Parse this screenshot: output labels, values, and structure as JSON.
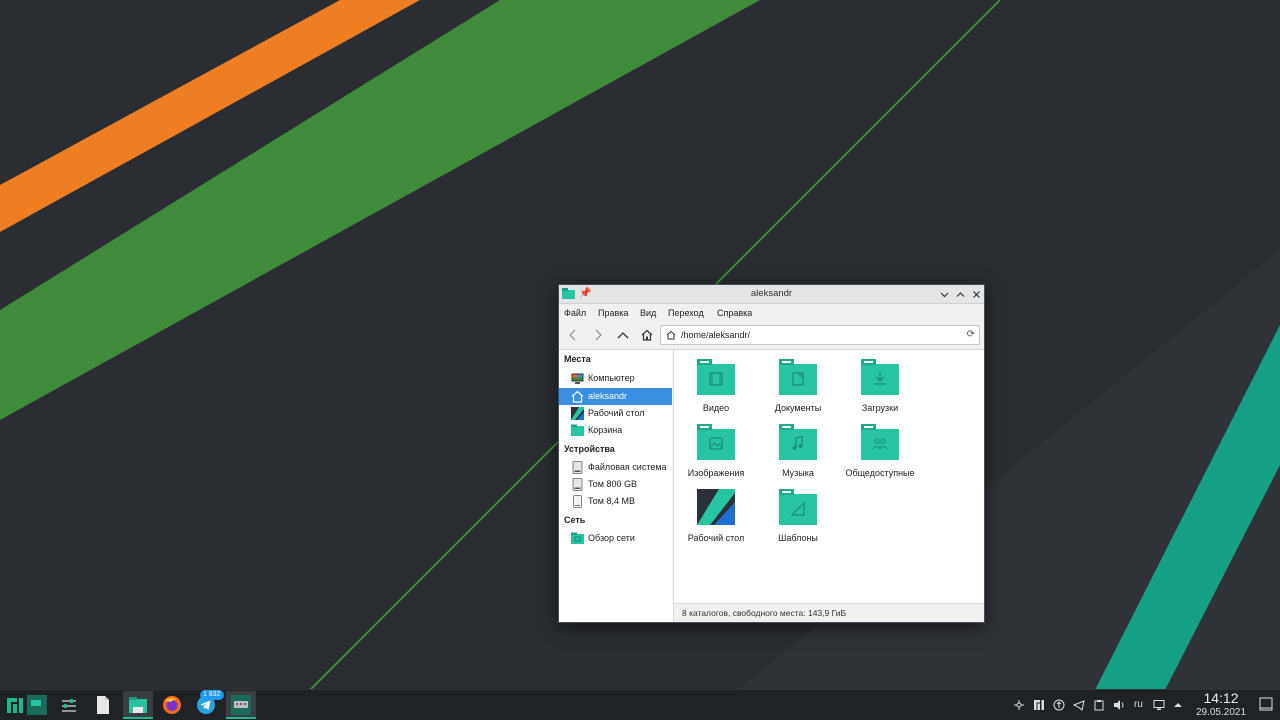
{
  "colors": {
    "wallpaper_dark": "#2a2d31",
    "stripe_orange": "#ef7d22",
    "stripe_green": "#3f8a3b",
    "stripe_teal": "#16a085",
    "folder_teal": "#27c4a2",
    "selection_blue": "#3a8fe0"
  },
  "window": {
    "title": "aleksandr",
    "menu": [
      "Файл",
      "Правка",
      "Вид",
      "Переход",
      "Справка"
    ],
    "address_path": "/home/aleksandr/",
    "sidebar": {
      "places_header": "Места",
      "places": [
        {
          "label": "Компьютер",
          "icon": "computer-icon"
        },
        {
          "label": "aleksandr",
          "icon": "home-icon",
          "active": true
        },
        {
          "label": "Рабочий стол",
          "icon": "desktop-icon"
        },
        {
          "label": "Корзина",
          "icon": "trash-icon"
        }
      ],
      "devices_header": "Устройства",
      "devices": [
        {
          "label": "Файловая система",
          "icon": "drive-icon"
        },
        {
          "label": "Том 800 GB",
          "icon": "drive-icon"
        },
        {
          "label": "Том 8,4 MB",
          "icon": "removable-drive-icon"
        }
      ],
      "network_header": "Сеть",
      "network": [
        {
          "label": "Обзор сети",
          "icon": "network-folder-icon"
        }
      ]
    },
    "items": [
      {
        "label": "Видео",
        "icon": "video-folder-icon"
      },
      {
        "label": "Документы",
        "icon": "documents-folder-icon"
      },
      {
        "label": "Загрузки",
        "icon": "downloads-folder-icon"
      },
      {
        "label": "Изображения",
        "icon": "pictures-folder-icon"
      },
      {
        "label": "Музыка",
        "icon": "music-folder-icon"
      },
      {
        "label": "Общедоступные",
        "icon": "public-folder-icon"
      },
      {
        "label": "Рабочий стол",
        "icon": "desktop-folder-icon"
      },
      {
        "label": "Шаблоны",
        "icon": "templates-folder-icon"
      }
    ],
    "status": "8 каталогов, свободного места: 143,9 ГиБ"
  },
  "taskbar": {
    "telegram_badge": "1 832",
    "keyboard_layout": "ru",
    "time": "14:12",
    "date": "29.05.2021"
  }
}
